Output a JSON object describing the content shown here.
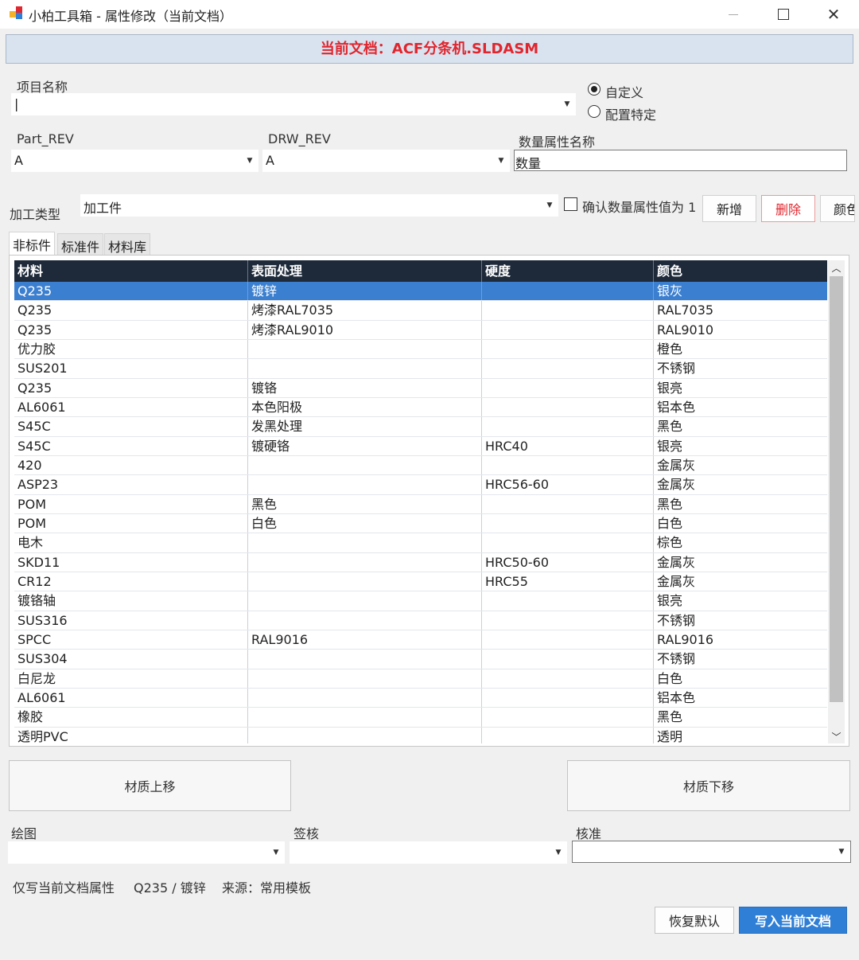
{
  "window": {
    "title": "小柏工具箱 - 属性修改（当前文档）",
    "minimize_icon": "minimize-icon",
    "maximize_icon": "maximize-icon",
    "close_icon": "close-icon",
    "close_glyph": "✕"
  },
  "banner": {
    "text": "当前文档：ACF分条机.SLDASM",
    "color": "#e0262e"
  },
  "project": {
    "label": "项目名称",
    "value": "|"
  },
  "mode": {
    "custom_label": "自定义",
    "config_label": "配置特定",
    "selected": "自定义"
  },
  "part_rev": {
    "label": "Part_REV",
    "value": "A"
  },
  "drw_rev": {
    "label": "DRW_REV",
    "value": "A"
  },
  "qty_prop": {
    "label": "数量属性名称",
    "value": "数量"
  },
  "process": {
    "label": "加工类型",
    "value": "加工件"
  },
  "confirm_qty": {
    "label": "确认数量属性值为 1",
    "checked": false
  },
  "buttons": {
    "add": "新增",
    "delete": "删除",
    "color": "颜色"
  },
  "tabs": [
    {
      "label": "非标件",
      "active": true
    },
    {
      "label": "标准件",
      "active": false
    },
    {
      "label": "材料库",
      "active": false
    }
  ],
  "table": {
    "headers": [
      "材料",
      "表面处理",
      "硬度",
      "颜色"
    ],
    "selected_row": 0,
    "rows": [
      [
        "Q235",
        "镀锌",
        "",
        "银灰"
      ],
      [
        "Q235",
        "烤漆RAL7035",
        "",
        "RAL7035"
      ],
      [
        "Q235",
        "烤漆RAL9010",
        "",
        "RAL9010"
      ],
      [
        "优力胶",
        "",
        "",
        "橙色"
      ],
      [
        "SUS201",
        "",
        "",
        "不锈钢"
      ],
      [
        "Q235",
        "镀铬",
        "",
        "银亮"
      ],
      [
        "AL6061",
        "本色阳极",
        "",
        "铝本色"
      ],
      [
        "S45C",
        "发黑处理",
        "",
        "黑色"
      ],
      [
        "S45C",
        "镀硬铬",
        "HRC40",
        "银亮"
      ],
      [
        "420",
        "",
        "",
        "金属灰"
      ],
      [
        "ASP23",
        "",
        "HRC56-60",
        "金属灰"
      ],
      [
        "POM",
        "黑色",
        "",
        "黑色"
      ],
      [
        "POM",
        "白色",
        "",
        "白色"
      ],
      [
        "电木",
        "",
        "",
        "棕色"
      ],
      [
        "SKD11",
        "",
        "HRC50-60",
        "金属灰"
      ],
      [
        "CR12",
        "",
        "HRC55",
        "金属灰"
      ],
      [
        "镀铬轴",
        "",
        "",
        "银亮"
      ],
      [
        "SUS316",
        "",
        "",
        "不锈钢"
      ],
      [
        "SPCC",
        "RAL9016",
        "",
        "RAL9016"
      ],
      [
        "SUS304",
        "",
        "",
        "不锈钢"
      ],
      [
        "白尼龙",
        "",
        "",
        "白色"
      ],
      [
        "AL6061",
        "",
        "",
        "铝本色"
      ],
      [
        "橡胶",
        "",
        "",
        "黑色"
      ],
      [
        "透明PVC",
        "",
        "",
        "透明"
      ]
    ]
  },
  "move": {
    "up": "材质上移",
    "down": "材质下移"
  },
  "sign": {
    "draw_label": "绘图",
    "check_label": "签核",
    "approve_label": "核准"
  },
  "status": {
    "scope": "仅写当前文档属性",
    "material": "Q235 / 镀锌",
    "source": "来源：常用模板"
  },
  "actions": {
    "restore": "恢复默认",
    "write": "写入当前文档"
  },
  "colors": {
    "accent": "#2f7fd6",
    "selection": "#3b7fd0",
    "header": "#1e2a3a",
    "danger": "#e0262e"
  }
}
